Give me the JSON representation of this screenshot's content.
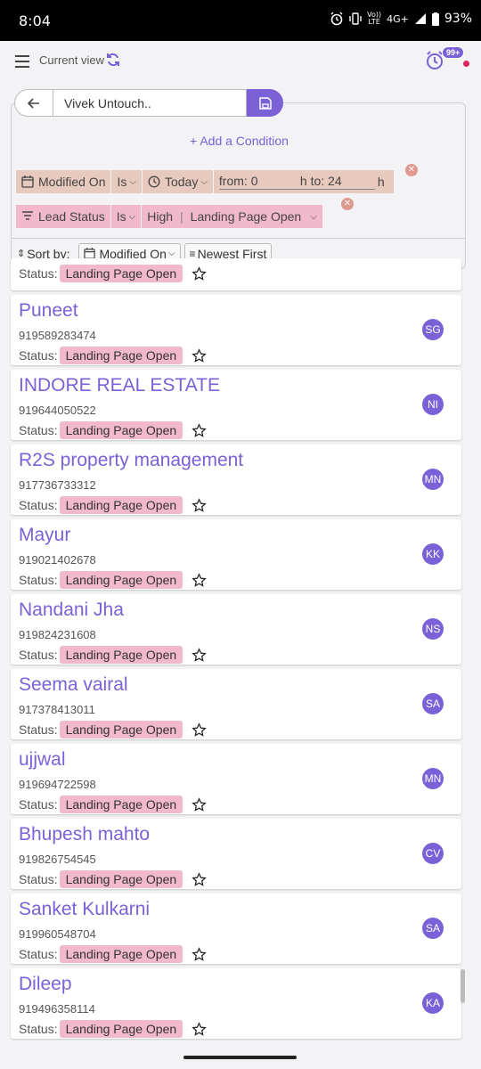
{
  "status_bar": {
    "time": "8:04",
    "network_top": "Vo))",
    "network_bottom": "LTE",
    "signal": "4G+",
    "battery": "93%"
  },
  "app_bar": {
    "view_label": "Current view",
    "notification_badge": "99+"
  },
  "search": {
    "value": "Vivek Untouch.."
  },
  "filters": {
    "add_condition": "+ Add a Condition",
    "conditions": [
      {
        "field": "Modified On",
        "operator": "Is",
        "value": "Today",
        "from_label": "from: 0",
        "to_label": "h to: 24",
        "unit": "h"
      },
      {
        "field": "Lead Status",
        "operator": "Is",
        "value1": "High",
        "value2": "Landing Page Open"
      }
    ],
    "sort": {
      "label": "Sort by:",
      "field": "Modified On",
      "order": "Newest First"
    }
  },
  "status_label": "Status:",
  "partial_card": {
    "status": "Landing Page Open"
  },
  "leads": [
    {
      "name": "Puneet",
      "phone": "919589283474",
      "status": "Landing Page Open",
      "initials": "SG"
    },
    {
      "name": "INDORE REAL ESTATE",
      "phone": "919644050522",
      "status": "Landing Page Open",
      "initials": "NI"
    },
    {
      "name": "R2S property management",
      "phone": "917736733312",
      "status": "Landing Page Open",
      "initials": "MN"
    },
    {
      "name": "Mayur",
      "phone": "919021402678",
      "status": "Landing Page Open",
      "initials": "KK"
    },
    {
      "name": "Nandani Jha",
      "phone": "919824231608",
      "status": "Landing Page Open",
      "initials": "NS"
    },
    {
      "name": "Seema vairal",
      "phone": "917378413011",
      "status": "Landing Page Open",
      "initials": "SA"
    },
    {
      "name": "ujjwal",
      "phone": "919694722598",
      "status": "Landing Page Open",
      "initials": "MN"
    },
    {
      "name": "Bhupesh mahto",
      "phone": "919826754545",
      "status": "Landing Page Open",
      "initials": "CV"
    },
    {
      "name": "Sanket Kulkarni",
      "phone": "919960548704",
      "status": "Landing Page Open",
      "initials": "SA"
    },
    {
      "name": "Dileep",
      "phone": "919496358114",
      "status": "Landing Page Open",
      "initials": "KA"
    }
  ],
  "colors": {
    "accent": "#7b61d8",
    "chip_pink": "#f2b9cc",
    "chip_tan": "#e8c9bd"
  }
}
